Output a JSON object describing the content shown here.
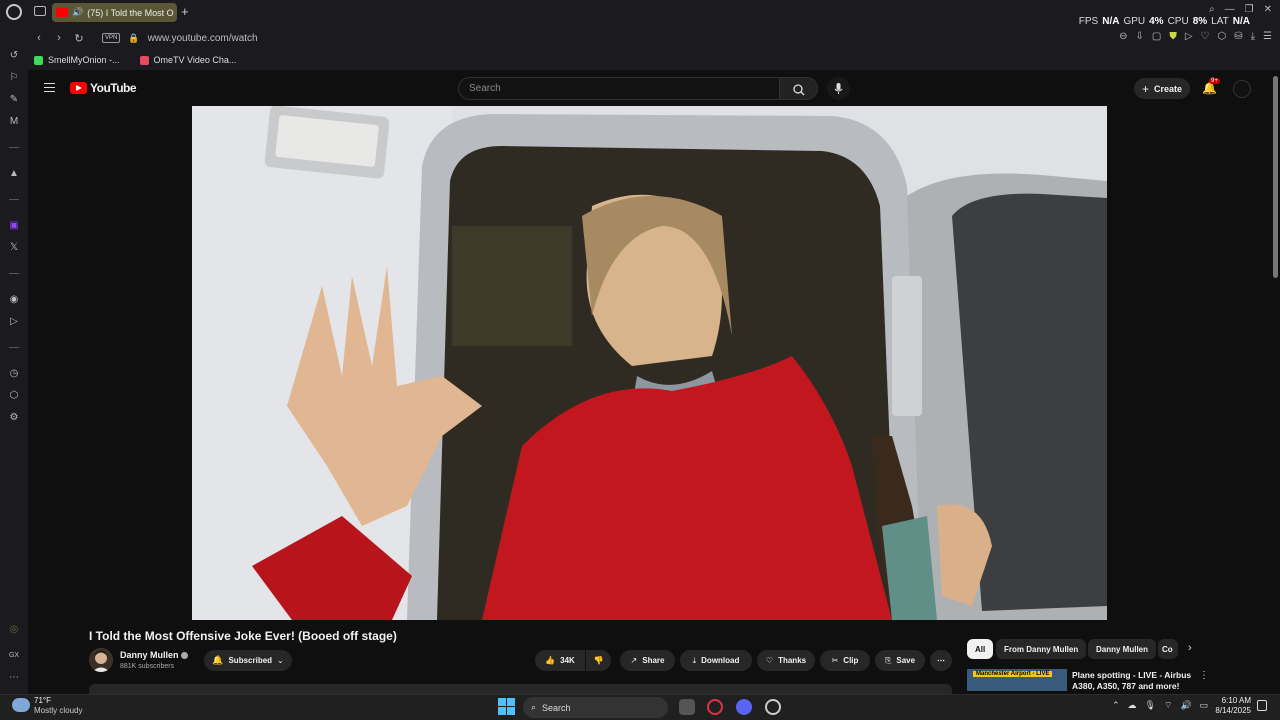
{
  "browser": {
    "tab_title": "(75) I Told the Most O",
    "url": "www.youtube.com/watch",
    "vpn_label": "VPN",
    "stats": {
      "fps_label": "FPS",
      "fps_value": "N/A",
      "gpu_label": "GPU",
      "gpu_value": "4%",
      "cpu_label": "CPU",
      "cpu_value": "8%",
      "lat_label": "LAT",
      "lat_value": "N/A"
    },
    "bookmarks": [
      {
        "label": "SmellMyOnion -...",
        "color": "#3ddc5a"
      },
      {
        "label": "OmeTV Video Cha...",
        "color": "#e84a5f"
      }
    ]
  },
  "youtube": {
    "logo_text": "YouTube",
    "search_placeholder": "Search",
    "create_label": "Create",
    "notification_count": "9+",
    "video": {
      "title": "I Told the Most Offensive Joke Ever! (Booed off stage)",
      "channel": "Danny Mullen",
      "subscribers": "881K subscribers",
      "subscribed_label": "Subscribed",
      "likes": "34K",
      "share_label": "Share",
      "download_label": "Download",
      "thanks_label": "Thanks",
      "clip_label": "Clip",
      "save_label": "Save"
    },
    "chips": [
      {
        "label": "All"
      },
      {
        "label": "From Danny Mullen"
      },
      {
        "label": "Danny Mullen"
      },
      {
        "label": "Co"
      }
    ],
    "recommended": {
      "thumb_label": "Manchester Airport - LIVE",
      "title": "Plane spotting - LIVE - Airbus A380, A350, 787 and more!"
    }
  },
  "taskbar": {
    "weather_temp": "71°F",
    "weather_desc": "Mostly cloudy",
    "search_label": "Search",
    "time": "6:10 AM",
    "date": "8/14/2025"
  },
  "colors": {
    "accent_red": "#ff0000",
    "page_bg": "#0f0f0f"
  }
}
